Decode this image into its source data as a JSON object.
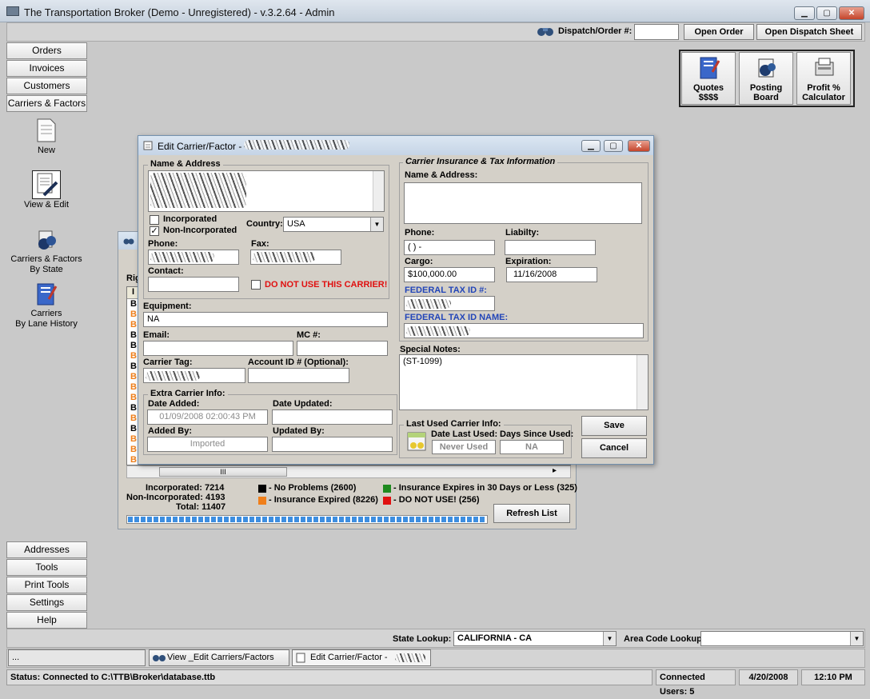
{
  "app": {
    "title": "The Transportation Broker (Demo - Unregistered) - v.3.2.64 - Admin",
    "min": "▁",
    "max": "▢",
    "close": "✕"
  },
  "toolbar": {
    "dispatch_label": "Dispatch/Order #:",
    "dispatch_value": "",
    "open_order": "Open Order",
    "open_dispatch": "Open Dispatch Sheet"
  },
  "big_tools": [
    {
      "label1": "Quotes",
      "label2": "$$$$"
    },
    {
      "label1": "Posting",
      "label2": "Board"
    },
    {
      "label1": "Profit %",
      "label2": "Calculator"
    }
  ],
  "nav_top": [
    "Orders",
    "Invoices",
    "Customers",
    "Carriers & Factors"
  ],
  "nav_icons": [
    {
      "line1": "New",
      "line2": ""
    },
    {
      "line1": "View & Edit",
      "line2": ""
    },
    {
      "line1": "Carriers & Factors",
      "line2": "By State"
    },
    {
      "line1": "Carriers",
      "line2": "By Lane History"
    }
  ],
  "nav_bottom": [
    "Addresses",
    "Tools",
    "Print Tools",
    "Settings",
    "Help"
  ],
  "back_window": {
    "label_partial": "Rig",
    "col_partial": "I",
    "row_letters": [
      "B",
      "B",
      "B",
      "B",
      "B",
      "B",
      "B",
      "B",
      "B",
      "B",
      "B",
      "B",
      "B",
      "B",
      "B",
      "B"
    ],
    "row_orange": [
      false,
      true,
      true,
      false,
      false,
      true,
      false,
      true,
      true,
      true,
      false,
      true,
      false,
      true,
      true,
      true
    ],
    "scroll_mid": "III",
    "scroll_right": "▸",
    "incorporated": "Incorporated: 7214",
    "non_incorporated": "Non-Incorporated: 4193",
    "total": "Total: 11407",
    "legend": [
      {
        "text": "- No Problems (2600)",
        "color": "#000000"
      },
      {
        "text": "- Insurance Expired (8226)",
        "color": "#f07f1a"
      },
      {
        "text": "- Insurance Expires in 30 Days or Less (325)",
        "color": "#1f8a1f"
      },
      {
        "text": "- DO NOT USE! (256)",
        "color": "#e01010"
      }
    ],
    "refresh": "Refresh List",
    "progress": 1.0
  },
  "dialog": {
    "title": "Edit Carrier/Factor -",
    "name_address_legend": "Name & Address",
    "incorporated": "Incorporated",
    "non_incorporated": "Non-Incorporated",
    "incorporated_checked": "",
    "non_incorporated_checked": "✓",
    "country_label": "Country:",
    "country_value": "USA",
    "phone_label": "Phone:",
    "fax_label": "Fax:",
    "contact_label": "Contact:",
    "do_not_use": "DO NOT USE THIS CARRIER!",
    "equipment_label": "Equipment:",
    "equipment_value": "NA",
    "email_label": "Email:",
    "mc_label": "MC #:",
    "carrier_tag_label": "Carrier Tag:",
    "account_id_label": "Account ID # (Optional):",
    "extra_legend": "Extra Carrier Info:",
    "date_added_label": "Date Added:",
    "date_added_value": "01/09/2008 02:00:43 PM",
    "date_updated_label": "Date Updated:",
    "added_by_label": "Added By:",
    "added_by_value": "Imported",
    "updated_by_label": "Updated By:",
    "ins_legend": "Carrier Insurance & Tax Information",
    "ins_name_label": "Name & Address:",
    "ins_phone_label": "Phone:",
    "ins_phone_value": "(   )    -",
    "liability_label": "Liabilty:",
    "cargo_label": "Cargo:",
    "cargo_value": "$100,000.00",
    "expiration_label": "Expiration:",
    "expiration_value": "11/16/2008",
    "fed_tax_id_label": "FEDERAL TAX ID #:",
    "fed_tax_name_label": "FEDERAL TAX ID NAME:",
    "special_notes_label": "Special Notes:",
    "special_notes_value": "(ST-1099)",
    "last_used_legend": "Last Used Carrier Info:",
    "date_last_used_label": "Date Last Used:",
    "date_last_used_value": "Never Used",
    "days_since_label": "Days Since Used:",
    "days_since_value": "NA",
    "save": "Save",
    "cancel": "Cancel"
  },
  "lookup": {
    "state_label": "State Lookup:",
    "state_value": "CALIFORNIA - CA",
    "area_label": "Area Code Lookup:",
    "area_value": ""
  },
  "taskbar": {
    "dots": "...",
    "item1": "View _Edit Carriers/Factors",
    "item2": "Edit Carrier/Factor -"
  },
  "status": {
    "connection": "Status: Connected to C:\\TTB\\Broker\\database.ttb",
    "users": "Connected Users: 5",
    "date": "4/20/2008",
    "time": "12:10 PM"
  }
}
